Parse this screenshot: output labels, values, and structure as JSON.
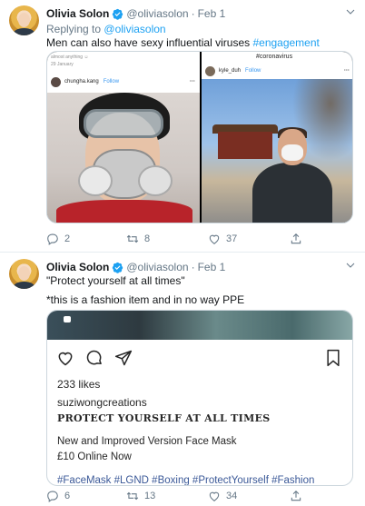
{
  "tweets": [
    {
      "author_name": "Olivia Solon",
      "handle": "@oliviasolon",
      "separator": "·",
      "date": "Feb 1",
      "reply_prefix": "Replying to",
      "reply_to": "@oliviasolon",
      "text": "Men can also have sexy influential viruses",
      "hashtag": "#engagement",
      "media": {
        "left_post": {
          "top_text": "almost anything ☺",
          "top_date": "29 January",
          "username": "chungha.kang",
          "follow": "Follow",
          "more": "···"
        },
        "right_post": {
          "header_tag": "#coronavirus",
          "username": "kyle_duh",
          "follow": "Follow",
          "more": "···"
        }
      },
      "actions": {
        "replies": "2",
        "retweets": "8",
        "likes": "37"
      }
    },
    {
      "author_name": "Olivia Solon",
      "handle": "@oliviasolon",
      "separator": "·",
      "date": "Feb 1",
      "text_line1": "\"Protect yourself at all times\"",
      "text_line2": "*this is a fashion item and in no way PPE",
      "instagram": {
        "likes": "233 likes",
        "username": "suziwongcreations",
        "caption_title": "PROTECT YOURSELF AT ALL TIMES",
        "line1": "New and Improved Version Face Mask",
        "line2": "£10 Online Now",
        "hashtags": "#FaceMask #LGND #Boxing #ProtectYourself #Fashion"
      },
      "actions": {
        "replies": "6",
        "retweets": "13",
        "likes": "34"
      }
    }
  ],
  "colors": {
    "link_blue": "#1da1f2",
    "secondary_text": "#657786",
    "primary_text": "#14171a",
    "border": "#ccd6dd"
  }
}
